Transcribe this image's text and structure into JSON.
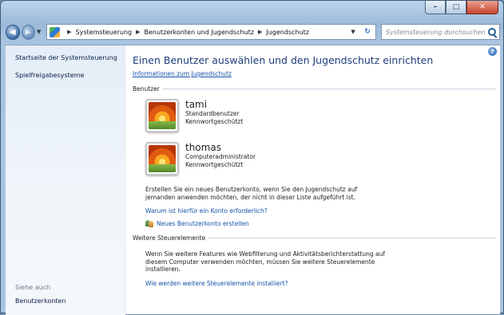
{
  "window": {
    "buttons": {
      "minimize": "–",
      "maximize": "□",
      "close": "✕"
    }
  },
  "nav": {
    "back_icon": "back-arrow-icon",
    "forward_icon": "forward-arrow-icon",
    "breadcrumbs": [
      "Systemsteuerung",
      "Benutzerkonten und Jugendschutz",
      "Jugendschutz"
    ],
    "search_placeholder": "Systemsteuerung durchsuchen"
  },
  "sidebar": {
    "items": [
      "Startseite der Systemsteuerung",
      "Spielfreigabesysteme"
    ],
    "see_also_heading": "Siehe auch",
    "see_also_items": [
      "Benutzerkonten"
    ]
  },
  "main": {
    "title": "Einen Benutzer auswählen und den Jugendschutz einrichten",
    "info_link": "Informationen zum Jugendschutz",
    "users_heading": "Benutzer",
    "users": [
      {
        "name": "tami",
        "role": "Standardbenutzer",
        "status": "Kennwortgeschützt"
      },
      {
        "name": "thomas",
        "role": "Computeradministrator",
        "status": "Kennwortgeschützt"
      }
    ],
    "create_hint": "Erstellen Sie ein neues Benutzerkonto, wenn Sie den Jugendschutz auf jemanden anwenden möchten, der nicht in dieser Liste aufgeführt ist.",
    "why_link": "Warum ist hierfür ein Konto erforderlich?",
    "new_account_link": "Neues Benutzerkonto erstellen",
    "more_heading": "Weitere Steuerelemente",
    "more_text": "Wenn Sie weitere Features wie Webfilterung und Aktivitätsberichterstattung auf diesem Computer verwenden möchten, müssen Sie weitere Steuerelemente installieren.",
    "more_link": "Wie werden weitere Steuerelemente installiert?"
  }
}
